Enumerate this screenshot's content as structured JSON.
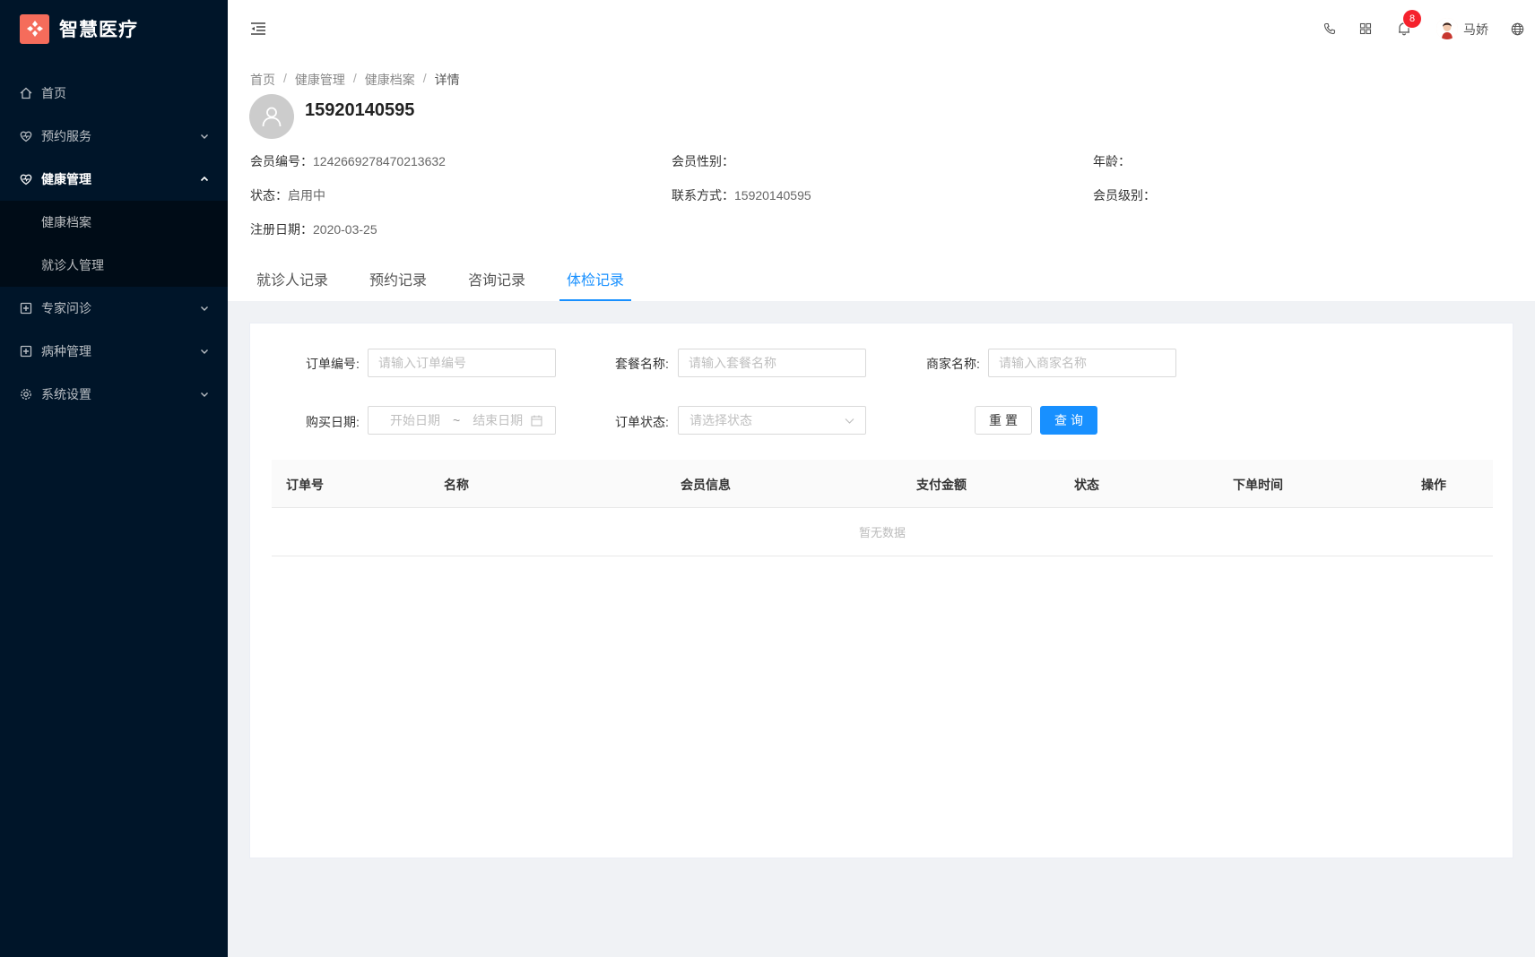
{
  "app": {
    "title": "智慧医疗"
  },
  "sidebar": {
    "items": [
      {
        "label": "首页"
      },
      {
        "label": "预约服务"
      },
      {
        "label": "健康管理"
      },
      {
        "label": "专家问诊"
      },
      {
        "label": "病种管理"
      },
      {
        "label": "系统设置"
      }
    ],
    "sub": [
      {
        "label": "健康档案"
      },
      {
        "label": "就诊人管理"
      }
    ]
  },
  "header": {
    "notification_count": "8",
    "user_name": "马娇"
  },
  "breadcrumb": [
    "首页",
    "健康管理",
    "健康档案",
    "详情"
  ],
  "breadcrumb_sep": "/",
  "member": {
    "phone_title": "15920140595",
    "id_label": "会员编号：",
    "id_value": "1242669278470213632",
    "gender_label": "会员性别：",
    "gender_value": "",
    "age_label": "年龄：",
    "age_value": "",
    "status_label": "状态：",
    "status_value": "启用中",
    "contact_label": "联系方式：",
    "contact_value": "15920140595",
    "level_label": "会员级别：",
    "level_value": "",
    "reg_label": "注册日期：",
    "reg_value": "2020-03-25"
  },
  "tabs": [
    {
      "label": "就诊人记录"
    },
    {
      "label": "预约记录"
    },
    {
      "label": "咨询记录"
    },
    {
      "label": "体检记录",
      "active": true
    }
  ],
  "filters": {
    "order_no_label": "订单编号:",
    "order_no_placeholder": "请输入订单编号",
    "package_label": "套餐名称:",
    "package_placeholder": "请输入套餐名称",
    "merchant_label": "商家名称:",
    "merchant_placeholder": "请输入商家名称",
    "date_label": "购买日期:",
    "date_start": "开始日期",
    "date_sep": "~",
    "date_end": "结束日期",
    "status_label": "订单状态:",
    "status_placeholder": "请选择状态",
    "reset_label": "重置",
    "query_label": "查询"
  },
  "table": {
    "columns": [
      "订单号",
      "名称",
      "会员信息",
      "支付金额",
      "状态",
      "下单时间",
      "操作"
    ],
    "empty_text": "暂无数据"
  },
  "colors": {
    "sidebar_bg": "#001529",
    "accent": "#1890ff",
    "logo": "#f56c5b",
    "badge": "#f5222d"
  }
}
